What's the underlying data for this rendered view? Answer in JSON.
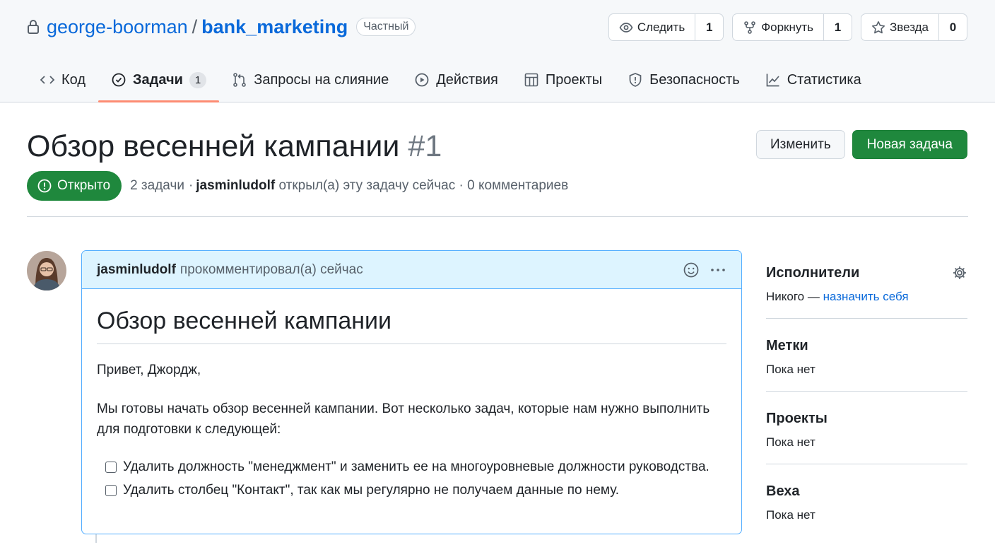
{
  "repo": {
    "owner": "george-boorman",
    "separator": "/",
    "name": "bank_marketing",
    "visibility": "Частный"
  },
  "repo_actions": [
    {
      "label": "Следить",
      "count": "1",
      "icon": "eye-icon"
    },
    {
      "label": "Форкнуть",
      "count": "1",
      "icon": "fork-icon"
    },
    {
      "label": "Звезда",
      "count": "0",
      "icon": "star-icon"
    }
  ],
  "tabs": [
    {
      "label": "Код",
      "icon": "code-icon"
    },
    {
      "label": "Задачи",
      "badge": "1",
      "icon": "issue-icon",
      "active": true
    },
    {
      "label": "Запросы на слияние",
      "icon": "pull-request-icon"
    },
    {
      "label": "Действия",
      "icon": "play-icon"
    },
    {
      "label": "Проекты",
      "icon": "table-icon"
    },
    {
      "label": "Безопасность",
      "icon": "shield-icon"
    },
    {
      "label": "Статистика",
      "icon": "graph-icon"
    }
  ],
  "issue": {
    "title": "Обзор весенней кампании",
    "number": "#1",
    "edit_label": "Изменить",
    "new_label": "Новая задача",
    "state": "Открыто",
    "tasks_count": "2 задачи",
    "dot": "·",
    "author": "jasminludolf",
    "opened_text": "открыл(а) эту задачу сейчас",
    "comments_text": "· 0 комментариев"
  },
  "comment": {
    "author": "jasminludolf",
    "action": "прокомментировал(а) сейчас",
    "heading": "Обзор весенней кампании",
    "greeting": "Привет, Джордж,",
    "paragraph": "Мы готовы начать обзор весенней кампании. Вот несколько задач, которые нам нужно выполнить для подготовки к следующей:",
    "tasks": [
      "Удалить должность \"менеджмент\" и заменить ее на многоуровневые должности руководства.",
      "Удалить столбец \"Контакт\", так как мы регулярно не получаем данные по нему."
    ]
  },
  "sidebar": {
    "assignees": {
      "title": "Исполнители",
      "none": "Никого —",
      "link": "назначить себя"
    },
    "labels": {
      "title": "Метки",
      "value": "Пока нет"
    },
    "projects": {
      "title": "Проекты",
      "value": "Пока нет"
    },
    "milestone": {
      "title": "Веха",
      "value": "Пока нет"
    }
  },
  "colors": {
    "accent": "#0969da",
    "open_green": "#1f883d",
    "tab_underline": "#fd8c73",
    "comment_header": "#ddf4ff"
  }
}
